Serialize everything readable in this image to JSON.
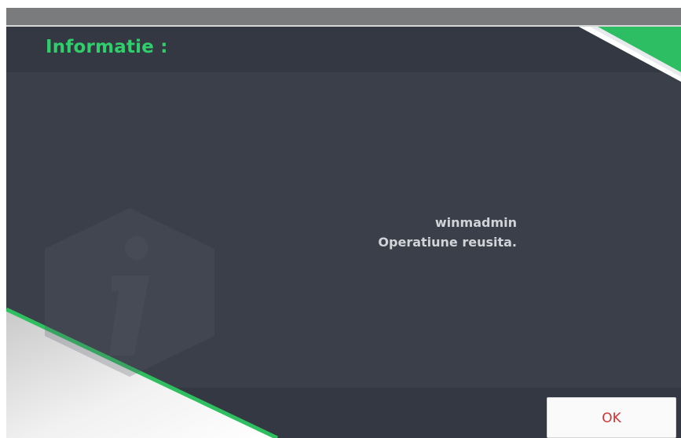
{
  "dialog": {
    "title": "Informatie :",
    "message": {
      "user": "winmadmin",
      "status": "Operatiune reusita."
    },
    "ok_label": "OK",
    "icon": "info-icon"
  },
  "colors": {
    "background": "#3b3f49",
    "header": "#343842",
    "accent": "#2fcf6c",
    "text": "#d1d3d8",
    "ok_text": "#d03434"
  }
}
